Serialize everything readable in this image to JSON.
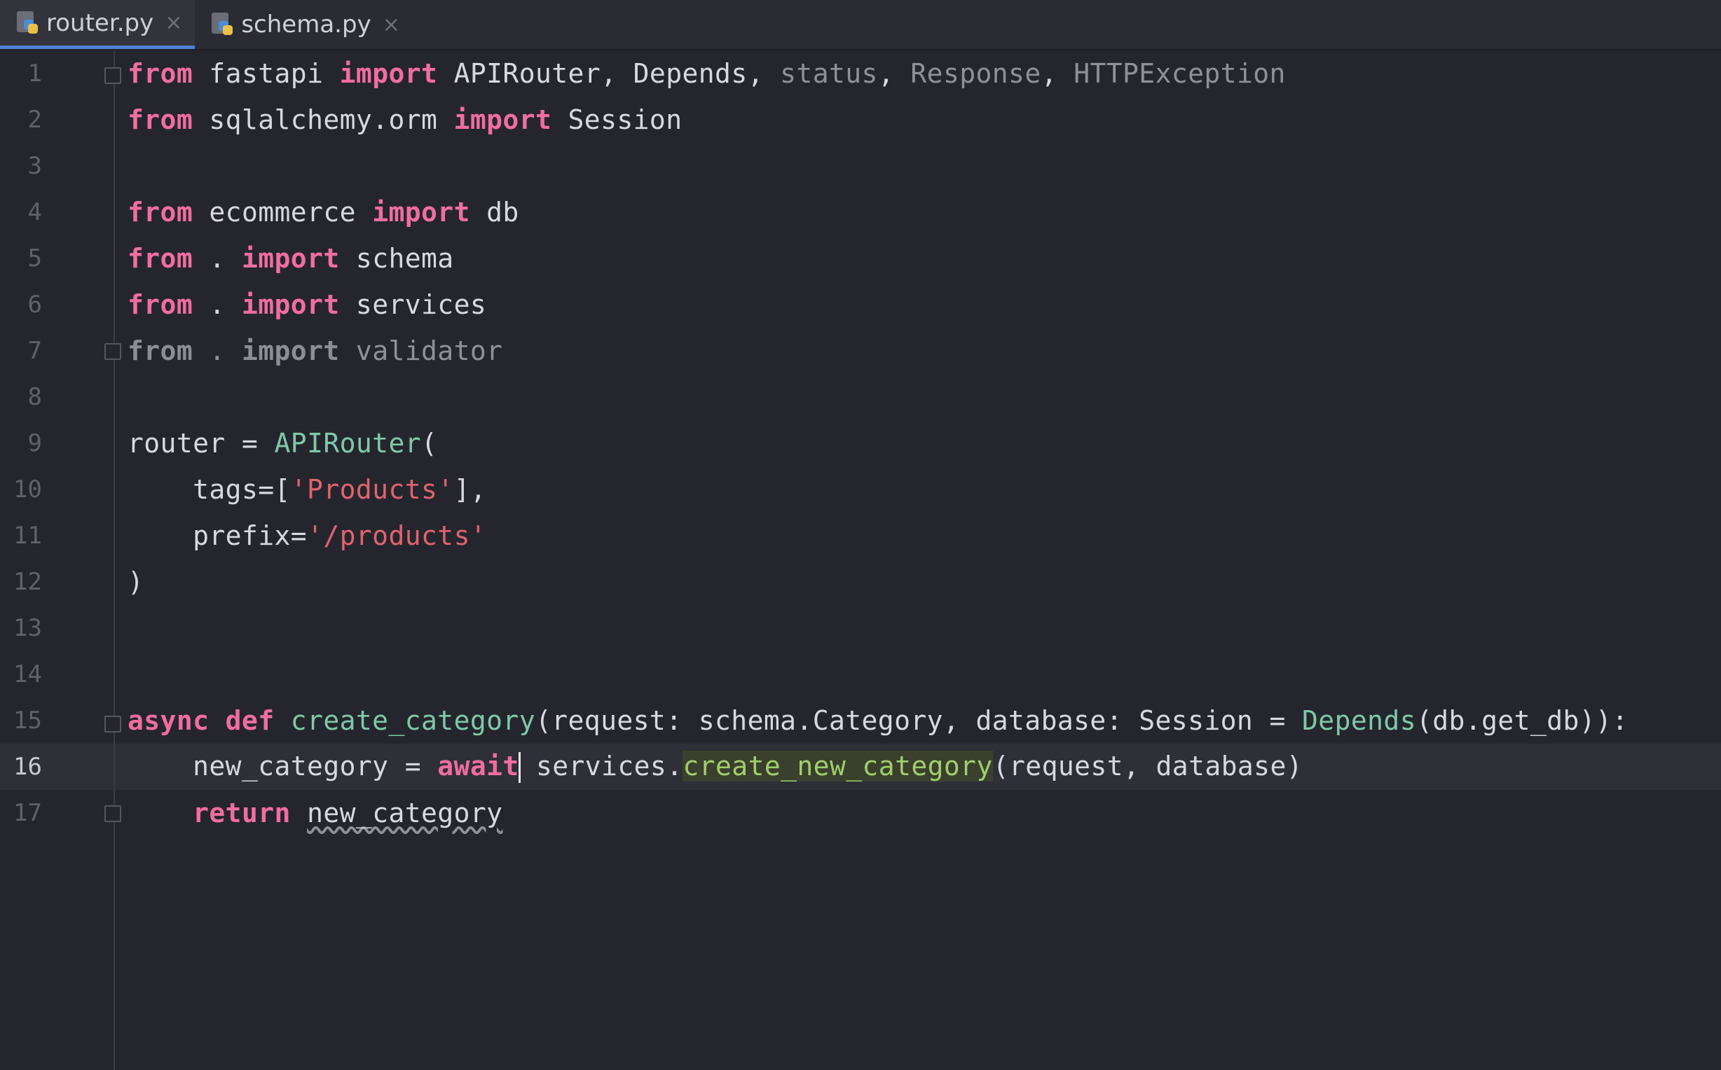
{
  "tabs": [
    {
      "label": "router.py",
      "active": true,
      "close_glyph": "×"
    },
    {
      "label": "schema.py",
      "active": false,
      "close_glyph": "×"
    }
  ],
  "editor": {
    "current_line": 16,
    "lines": [
      {
        "n": "1"
      },
      {
        "n": "2"
      },
      {
        "n": "3"
      },
      {
        "n": "4"
      },
      {
        "n": "5"
      },
      {
        "n": "6"
      },
      {
        "n": "7"
      },
      {
        "n": "8"
      },
      {
        "n": "9"
      },
      {
        "n": "10"
      },
      {
        "n": "11"
      },
      {
        "n": "12"
      },
      {
        "n": "13"
      },
      {
        "n": "14"
      },
      {
        "n": "15"
      },
      {
        "n": "16"
      },
      {
        "n": "17"
      }
    ],
    "code": {
      "l1": {
        "t1": "from",
        "t2": " fastapi ",
        "t3": "import",
        "t4": " APIRouter, Depends, ",
        "t5": "status",
        "t6": ", ",
        "t7": "Response",
        "t8": ", ",
        "t9": "HTTPException"
      },
      "l2": {
        "t1": "from",
        "t2": " sqlalchemy.orm ",
        "t3": "import",
        "t4": " Session"
      },
      "l4": {
        "t1": "from",
        "t2": " ecommerce ",
        "t3": "import",
        "t4": " db"
      },
      "l5": {
        "t1": "from",
        "t2": " . ",
        "t3": "import",
        "t4": " schema"
      },
      "l6": {
        "t1": "from",
        "t2": " . ",
        "t3": "import",
        "t4": " services"
      },
      "l7": {
        "t1": "from",
        "t2": " . ",
        "t3": "import",
        "t4": " validator"
      },
      "l9": {
        "t1": "router = ",
        "t2": "APIRouter",
        "t3": "("
      },
      "l10": {
        "t1": "    tags=[",
        "t2": "'Products'",
        "t3": "],"
      },
      "l11": {
        "t1": "    prefix=",
        "t2": "'/products'"
      },
      "l12": {
        "t1": ")"
      },
      "l15": {
        "t1": "async",
        "t2": " ",
        "t3": "def",
        "t4": " ",
        "t5": "create_category",
        "t6": "(request: schema.Category, database: Session = ",
        "t7": "Depends",
        "t8": "(db.get_db)):"
      },
      "l16": {
        "t1": "    new_category = ",
        "t2": "await",
        "t3": " services.",
        "t4": "create_new_category",
        "t5": "(request, database)"
      },
      "l17": {
        "t1": "    ",
        "t2": "return",
        "t3": " ",
        "t4": "new_category"
      }
    }
  },
  "icons": {
    "file_icon": "python-file-icon",
    "fold_icon": "fold-marker-icon"
  },
  "colors": {
    "keyword": "#f06e9d",
    "function": "#7fc9a8",
    "string": "#e0636f",
    "background": "#25262d",
    "tab_active_underline": "#4f7fd3"
  }
}
